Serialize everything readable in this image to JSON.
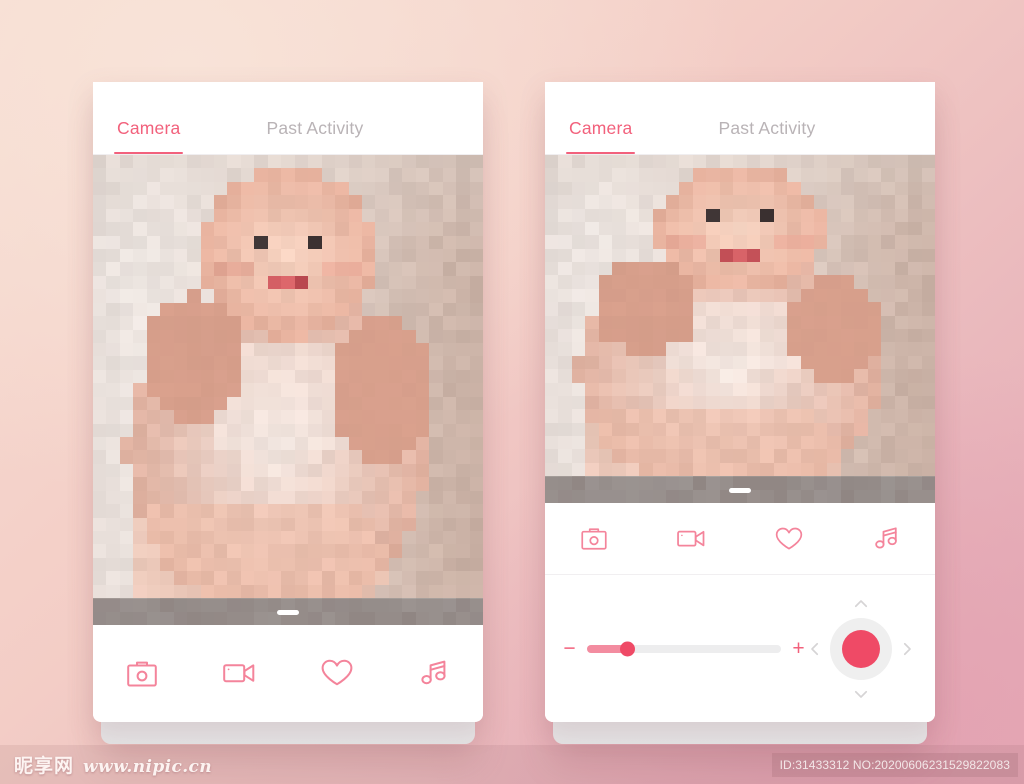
{
  "theme": {
    "accent": "#f2617c",
    "accent_strong": "#ef4a66",
    "accent_soft": "#f38ca0",
    "tab_inactive": "#b9b3b6",
    "bg_top_left": "#f7ddd2",
    "bg_bottom_right": "#e4a9b6",
    "card_bg": "#ffffff",
    "track_bg": "#ededee",
    "ring_bg": "#efefef",
    "chevron": "#d6d4d5"
  },
  "phones": [
    {
      "id": "phone-left",
      "tabs": [
        {
          "label": "Camera",
          "active": true
        },
        {
          "label": "Past Activity",
          "active": false
        }
      ],
      "viewport": {
        "name": "camera-preview",
        "handle_name": "drawer-handle"
      },
      "toolbar": [
        {
          "name": "photo-capture-icon",
          "icon": "camera-icon",
          "label": "Photo"
        },
        {
          "name": "video-record-icon",
          "icon": "video-camera-icon",
          "label": "Video"
        },
        {
          "name": "favorite-icon",
          "icon": "heart-icon",
          "label": "Favorite"
        },
        {
          "name": "lullaby-icon",
          "icon": "music-note-icon",
          "label": "Music"
        }
      ],
      "has_controls": false
    },
    {
      "id": "phone-right",
      "tabs": [
        {
          "label": "Camera",
          "active": true
        },
        {
          "label": "Past Activity",
          "active": false
        }
      ],
      "viewport": {
        "name": "camera-preview",
        "handle_name": "drawer-handle"
      },
      "toolbar": [
        {
          "name": "photo-capture-icon",
          "icon": "camera-icon",
          "label": "Photo"
        },
        {
          "name": "video-record-icon",
          "icon": "video-camera-icon",
          "label": "Video"
        },
        {
          "name": "favorite-icon",
          "icon": "heart-icon",
          "label": "Favorite"
        },
        {
          "name": "lullaby-icon",
          "icon": "music-note-icon",
          "label": "Music"
        }
      ],
      "has_controls": true,
      "controls": {
        "volume": {
          "decrease_label": "−",
          "increase_label": "+",
          "value_percent": 21
        },
        "dpad": {
          "up_label": "Pan up",
          "down_label": "Pan down",
          "left_label": "Pan left",
          "right_label": "Pan right",
          "record_label": "Record"
        }
      }
    }
  ],
  "watermark": {
    "site_cn": "昵享网",
    "site_url": "www.nipic.cn",
    "asset_id": "ID:31433312 NO:20200606231529822083"
  }
}
